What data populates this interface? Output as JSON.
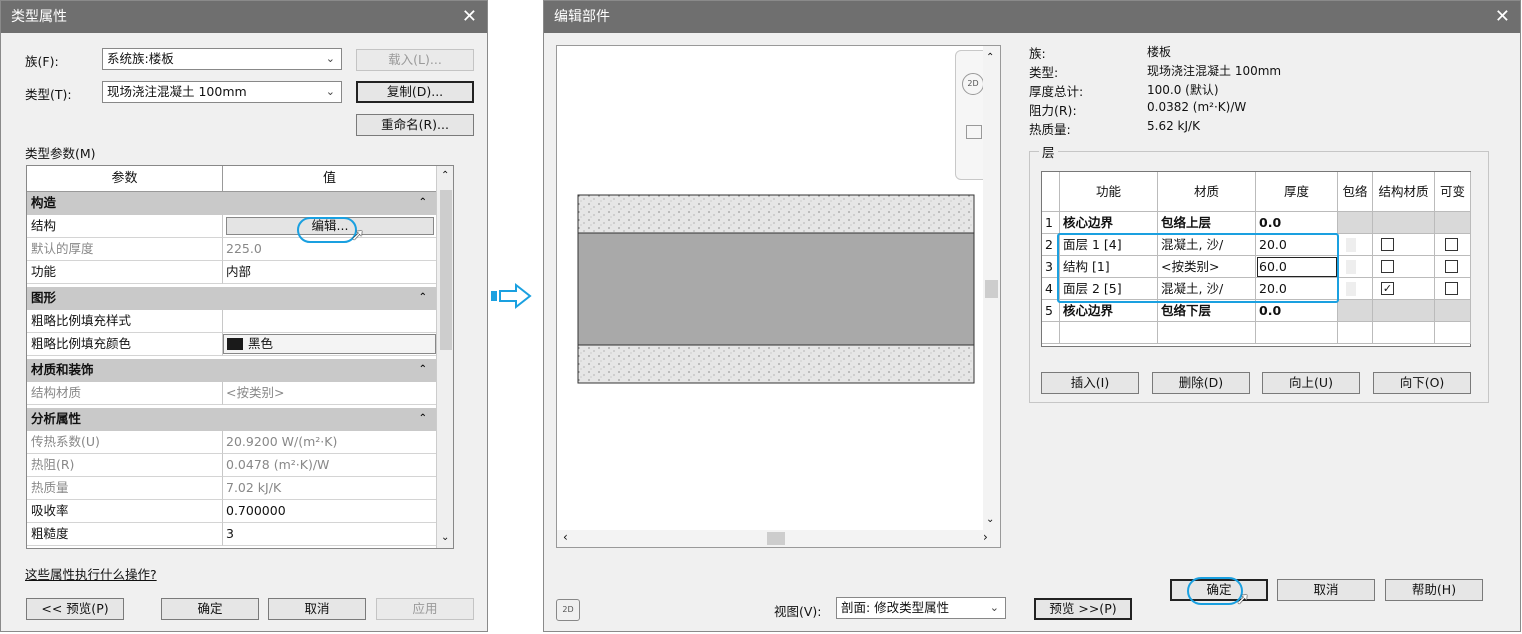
{
  "left_dialog": {
    "title": "类型属性",
    "family_label": "族(F):",
    "family_value": "系统族:楼板",
    "type_label": "类型(T):",
    "type_value": "现场浇注混凝土 100mm",
    "load_button": "载入(L)...",
    "duplicate_button": "复制(D)...",
    "rename_button": "重命名(R)...",
    "type_params_label": "类型参数(M)",
    "col_param": "参数",
    "col_value": "值",
    "col_eq": "=",
    "groups": [
      {
        "name": "构造",
        "rows": [
          {
            "param": "结构",
            "value": "编辑...",
            "is_button": true
          },
          {
            "param": "默认的厚度",
            "value": "225.0",
            "grey": true
          },
          {
            "param": "功能",
            "value": "内部"
          }
        ]
      },
      {
        "name": "图形",
        "rows": [
          {
            "param": "粗略比例填充样式",
            "value": ""
          },
          {
            "param": "粗略比例填充颜色",
            "value": "黑色",
            "swatch": "#1a1a1a"
          }
        ]
      },
      {
        "name": "材质和装饰",
        "rows": [
          {
            "param": "结构材质",
            "value": "<按类别>",
            "grey": true
          }
        ]
      },
      {
        "name": "分析属性",
        "rows": [
          {
            "param": "传热系数(U)",
            "value": "20.9200 W/(m²·K)",
            "grey": true
          },
          {
            "param": "热阻(R)",
            "value": "0.0478 (m²·K)/W",
            "grey": true
          },
          {
            "param": "热质量",
            "value": "7.02 kJ/K",
            "grey": true
          },
          {
            "param": "吸收率",
            "value": "0.700000"
          },
          {
            "param": "粗糙度",
            "value": "3"
          }
        ]
      }
    ],
    "help_link": "这些属性执行什么操作?",
    "preview_button": "<< 预览(P)",
    "ok_button": "确定",
    "cancel_button": "取消",
    "apply_button": "应用"
  },
  "right_dialog": {
    "title": "编辑部件",
    "info": [
      {
        "label": "族:",
        "value": "楼板"
      },
      {
        "label": "类型:",
        "value": "现场浇注混凝土 100mm"
      },
      {
        "label": "厚度总计:",
        "value": "100.0 (默认)"
      },
      {
        "label": "阻力(R):",
        "value": "0.0382 (m²·K)/W"
      },
      {
        "label": "热质量:",
        "value": "5.62 kJ/K"
      }
    ],
    "layers_label": "层",
    "layer_columns": [
      "功能",
      "材质",
      "厚度",
      "包络",
      "结构材质",
      "可变"
    ],
    "layers": [
      {
        "num": "1",
        "function": "核心边界",
        "material": "包络上层",
        "thickness": "0.0",
        "bold": true
      },
      {
        "num": "2",
        "function": "面层 1 [4]",
        "material": "混凝土, 沙/",
        "thickness": "20.0",
        "wrap": "",
        "structural": "",
        "variable": ""
      },
      {
        "num": "3",
        "function": "结构 [1]",
        "material": "<按类别>",
        "thickness": "60.0",
        "wrap": "",
        "structural": "",
        "variable": ""
      },
      {
        "num": "4",
        "function": "面层 2 [5]",
        "material": "混凝土, 沙/",
        "thickness": "20.0",
        "wrap": "",
        "structural": "✓",
        "variable": ""
      },
      {
        "num": "5",
        "function": "核心边界",
        "material": "包络下层",
        "thickness": "0.0",
        "bold": true
      }
    ],
    "insert_button": "插入(I)",
    "delete_button": "删除(D)",
    "up_button": "向上(U)",
    "down_button": "向下(O)",
    "view_label": "视图(V):",
    "view_value": "剖面: 修改类型属性",
    "preview_button": "预览 >>(P)",
    "ok_button": "确定",
    "cancel_button": "取消",
    "help_button": "帮助(H)"
  },
  "colors": {
    "highlight": "#1aa0e0",
    "titlebar": "#6f6f6f",
    "group_row": "#c9c9c9"
  }
}
